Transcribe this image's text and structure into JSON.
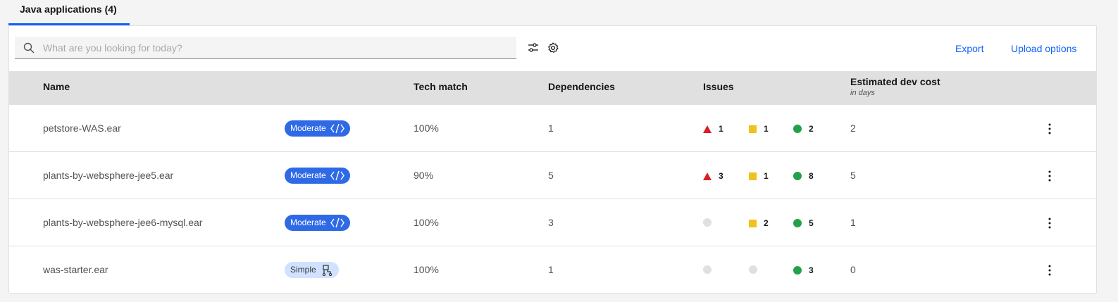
{
  "tabs": [
    {
      "label": "Java applications (4)"
    }
  ],
  "toolbar": {
    "search_placeholder": "What are you looking for today?",
    "export_label": "Export",
    "upload_label": "Upload options"
  },
  "table": {
    "headers": {
      "name": "Name",
      "tech_match": "Tech match",
      "dependencies": "Dependencies",
      "issues": "Issues",
      "cost": "Estimated dev cost",
      "cost_sub": "in days"
    },
    "rows": [
      {
        "name": "petstore-WAS.ear",
        "complexity": "Moderate",
        "tech_match": "100%",
        "dependencies": "1",
        "issues": {
          "critical": "1",
          "potential": "1",
          "info": "2"
        },
        "cost": "2"
      },
      {
        "name": "plants-by-websphere-jee5.ear",
        "complexity": "Moderate",
        "tech_match": "90%",
        "dependencies": "5",
        "issues": {
          "critical": "3",
          "potential": "1",
          "info": "8"
        },
        "cost": "5"
      },
      {
        "name": "plants-by-websphere-jee6-mysql.ear",
        "complexity": "Moderate",
        "tech_match": "100%",
        "dependencies": "3",
        "issues": {
          "critical": "",
          "potential": "2",
          "info": "5"
        },
        "cost": "1"
      },
      {
        "name": "was-starter.ear",
        "complexity": "Simple",
        "tech_match": "100%",
        "dependencies": "1",
        "issues": {
          "critical": "",
          "potential": "",
          "info": "3"
        },
        "cost": "0"
      }
    ]
  },
  "colors": {
    "accent": "#0f62fe",
    "critical": "#da1e28",
    "potential": "#f1c21b",
    "info": "#24a148",
    "none": "#e0e0e0",
    "moderate_tag": "#2f6ae6",
    "simple_tag": "#d0e2ff"
  },
  "icons": {
    "search": "search-icon",
    "filter": "sliders-icon",
    "settings": "gear-icon",
    "moderate": "code-icon",
    "simple": "flow-icon",
    "overflow": "overflow-menu-icon"
  }
}
